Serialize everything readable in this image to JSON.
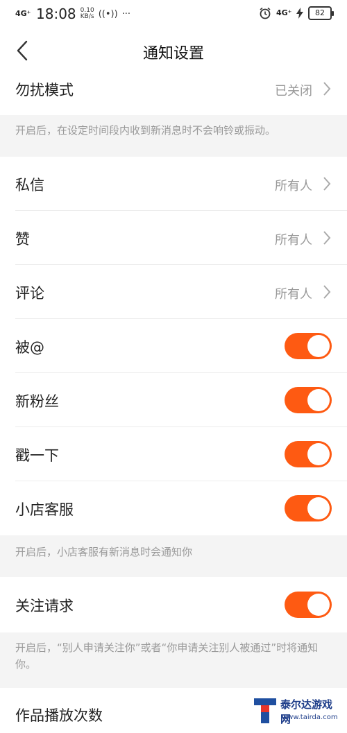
{
  "status_bar": {
    "signal": "4G⁺",
    "time": "18:08",
    "speed_value": "0.10",
    "speed_unit": "KB/s",
    "hotspot_icon": "hotspot-icon",
    "more": "···",
    "network": "4G⁺",
    "battery": "82"
  },
  "header": {
    "title": "通知设置",
    "back_icon": "back-chevron-icon"
  },
  "dnd": {
    "label": "勿扰模式",
    "value": "已关闭",
    "note": "开启后，在设定时间段内收到新消息时不会响铃或振动。"
  },
  "items": [
    {
      "label": "私信",
      "value": "所有人"
    },
    {
      "label": "赞",
      "value": "所有人"
    },
    {
      "label": "评论",
      "value": "所有人"
    }
  ],
  "toggles": [
    {
      "label": "被@",
      "on": true
    },
    {
      "label": "新粉丝",
      "on": true
    },
    {
      "label": "戳一下",
      "on": true
    },
    {
      "label": "小店客服",
      "on": true
    }
  ],
  "shop_note": "开启后，小店客服有新消息时会通知你",
  "follow": {
    "label": "关注请求",
    "on": true,
    "note": "开启后，“别人申请关注你”或者“你申请关注别人被通过”时将通知你。"
  },
  "play_count": {
    "label": "作品播放次数"
  },
  "watermark": {
    "text": "泰尔达游戏网",
    "url": "www.tairda.com"
  },
  "colors": {
    "accent": "#fe5a12",
    "note_bg": "#f4f4f4"
  }
}
